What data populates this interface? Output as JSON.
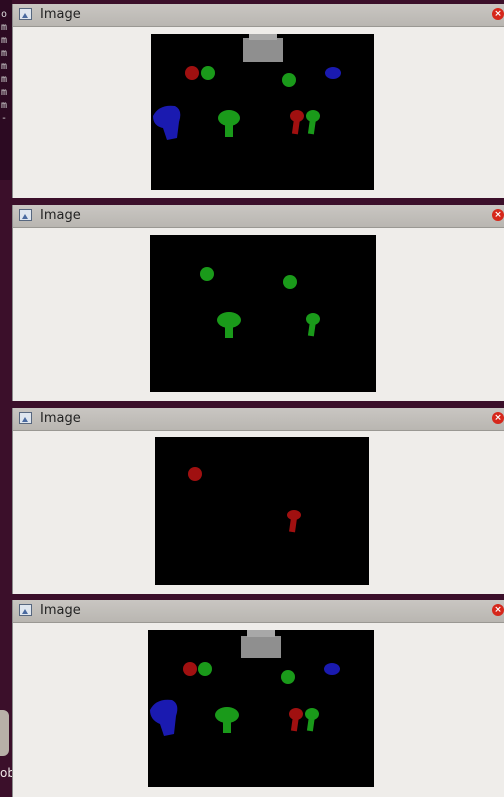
{
  "terminal": {
    "lines": [
      "o",
      "m",
      "m",
      "m",
      "m",
      "m",
      "m",
      "m",
      "-"
    ]
  },
  "launcher": {
    "label": "ob"
  },
  "windows": [
    {
      "title": "Image",
      "close_label": "×"
    },
    {
      "title": "Image",
      "close_label": "×"
    },
    {
      "title": "Image",
      "close_label": "×"
    },
    {
      "title": "Image",
      "close_label": "×"
    }
  ],
  "colors": {
    "red": "#a01010",
    "green": "#1a9a1a",
    "blue": "#1a1ab0",
    "gray": "#8f8f8f"
  }
}
